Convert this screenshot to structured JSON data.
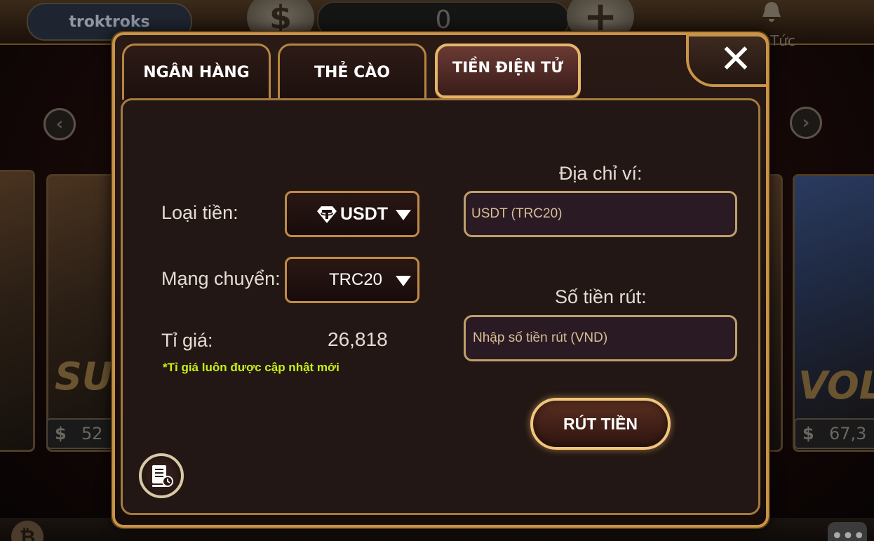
{
  "background": {
    "username": "troktroks",
    "balance": "0",
    "coin_symbol": "$",
    "plus_symbol": "+",
    "news_label": "Tức",
    "game_card_left": {
      "title": "SU",
      "price_prefix": "$",
      "price": "52"
    },
    "game_card_right": {
      "title": "VOL",
      "price_prefix": "$",
      "price": "67,3"
    },
    "nav_prev": "‹",
    "nav_next": "›",
    "bottom_left_symbol": "₿",
    "bottom_right_symbol": "•••"
  },
  "modal": {
    "tabs": [
      {
        "label": "NGÂN HÀNG",
        "active": false
      },
      {
        "label": "THẺ CÀO",
        "active": false
      },
      {
        "label": "TIỀN ĐIỆN TỬ",
        "active": true
      }
    ],
    "close_symbol": "✕",
    "form": {
      "currency_label": "Loại tiền:",
      "currency_value": "USDT",
      "network_label": "Mạng chuyển:",
      "network_value": "TRC20",
      "rate_label": "Tỉ giá:",
      "rate_value": "26,818",
      "rate_note": "*Tỉ giá luôn được cập nhật mới",
      "wallet_label": "Địa chỉ ví:",
      "wallet_value": "USDT (TRC20)",
      "amount_label": "Số tiền rút:",
      "amount_placeholder": "Nhập số tiền rút (VND)",
      "amount_value": ""
    },
    "submit_label": "RÚT TIỀN"
  },
  "colors": {
    "gold_border": "#c99447",
    "rate_note": "#c6f018",
    "placeholder": "#d9bf96"
  }
}
